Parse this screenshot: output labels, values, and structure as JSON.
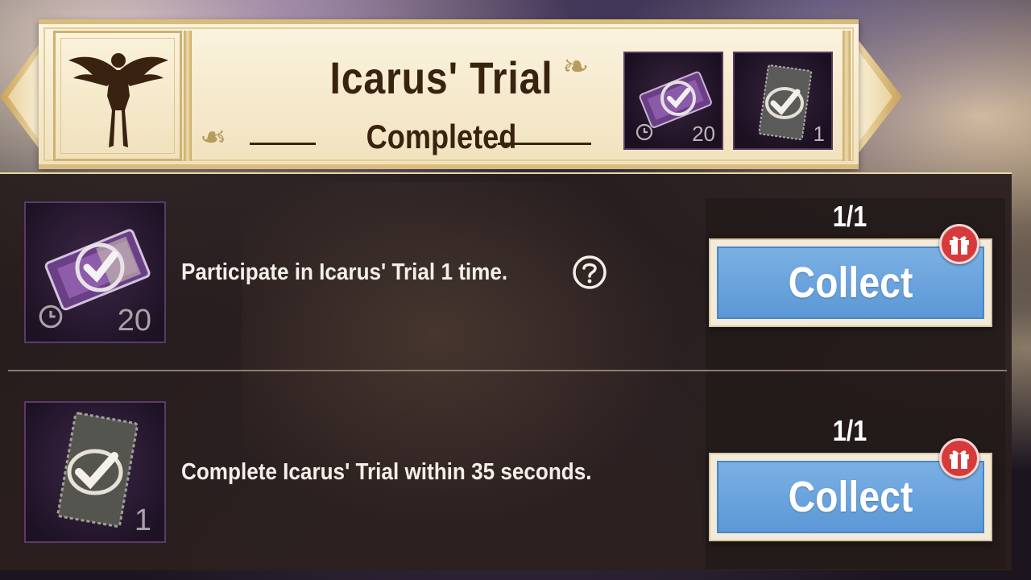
{
  "banner": {
    "title": "Icarus' Trial",
    "subtitle": "Completed",
    "emblem_icon": "winged-figure-icon",
    "rewards": [
      {
        "icon": "purple-ticket-icon",
        "count": "20",
        "timed": true
      },
      {
        "icon": "check-voucher-icon",
        "count": "1",
        "timed": false
      }
    ]
  },
  "tasks": [
    {
      "description": "Participate in Icarus' Trial 1 time.",
      "has_help": true,
      "reward_icon": "purple-ticket-icon",
      "reward_count": "20",
      "progress": "1/1",
      "button_label": "Collect"
    },
    {
      "description": "Complete Icarus' Trial within 35 seconds.",
      "has_help": false,
      "reward_icon": "check-voucher-icon",
      "reward_count": "1",
      "progress": "1/1",
      "button_label": "Collect"
    }
  ],
  "colors": {
    "banner_text": "#3a2210",
    "button_blue": "#6aa4dd",
    "gift_red": "#d63a3a",
    "panel_bg": "#261c1c"
  }
}
